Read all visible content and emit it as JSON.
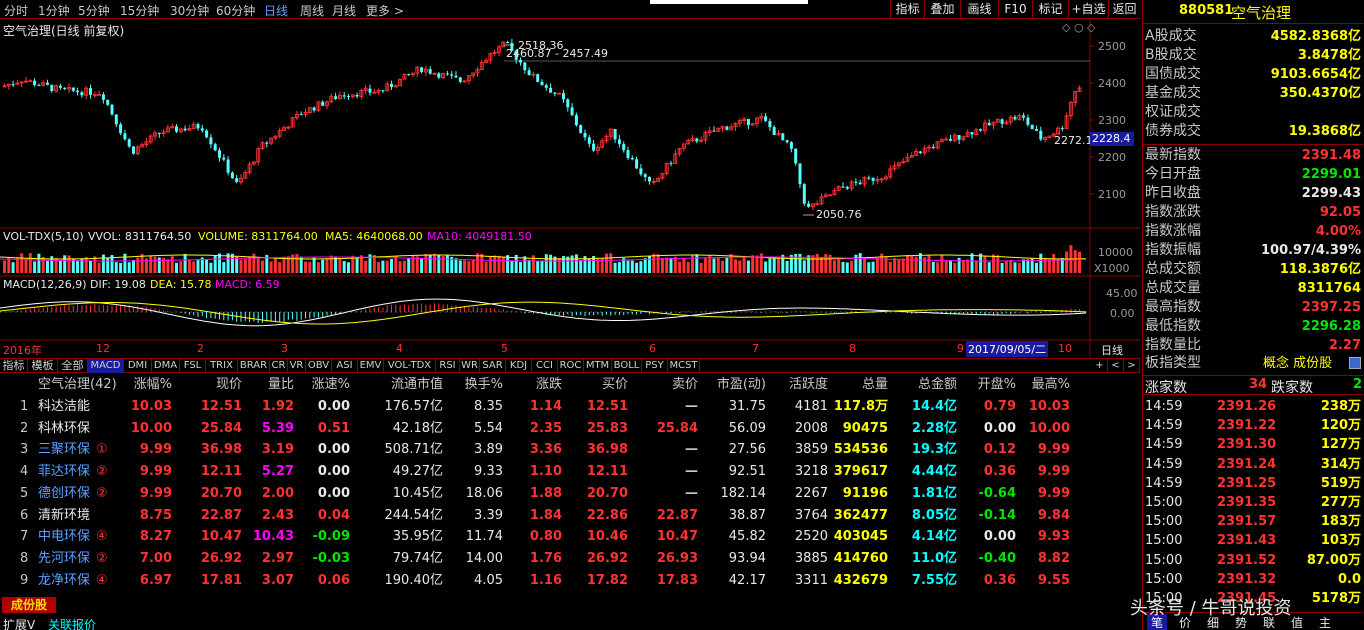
{
  "toolbar": {
    "periods": [
      "分时",
      "1分钟",
      "5分钟",
      "15分钟",
      "30分钟",
      "60分钟",
      "日线",
      "周线",
      "月线",
      "更多 >"
    ],
    "buttons": [
      "指标",
      "叠加",
      "画线",
      "F10",
      "标记",
      "+自选",
      "返回"
    ]
  },
  "chart": {
    "title": "空气治理(日线 前复权)",
    "y_ticks": [
      "2500",
      "2400",
      "2300",
      "2200",
      "2100"
    ],
    "high_label": "2518.36",
    "range_label": "2460.87 - 2457.49",
    "low_label": "2050.76",
    "last_label": "2272.1",
    "price_box": "2228.4",
    "vol_header": {
      "name": "VOL-TDX(5,10)",
      "vvol": "VVOL: 8311764.50",
      "volume": "VOLUME: 8311764.00",
      "ma5": "MA5: 4640068.00",
      "ma10": "MA10: 4049181.50"
    },
    "vol_ticks": [
      "10000",
      "X1000"
    ],
    "macd_header": {
      "name": "MACD(12,26,9)",
      "dif": "DIF: 19.08",
      "dea": "DEA: 15.78",
      "macd": "MACD: 6.59"
    },
    "macd_ticks": [
      "45.00",
      "0.00"
    ],
    "dates": [
      "2016年",
      "12",
      "2",
      "3",
      "4",
      "5",
      "6",
      "7",
      "8",
      "9",
      "10"
    ],
    "cursor_date": "2017/09/05/二",
    "period_label": "日线"
  },
  "tabs": [
    "指标",
    "模板",
    "全部",
    "MACD",
    "DMI",
    "DMA",
    "FSL",
    "TRIX",
    "BRAR",
    "CR",
    "VR",
    "OBV",
    "ASI",
    "EMV",
    "VOL-TDX",
    "RSI",
    "WR",
    "SAR",
    "KDJ",
    "CCI",
    "ROC",
    "MTM",
    "BOLL",
    "PSY",
    "MCST"
  ],
  "tab_nav": [
    "+",
    "<",
    ">"
  ],
  "table": {
    "headers": [
      "空气治理(42)",
      "涨幅%",
      "现价",
      "量比",
      "涨速%",
      "流通市值",
      "换手%",
      "涨跌",
      "买价",
      "卖价",
      "市盈(动)",
      "活跃度",
      "总量",
      "总金额",
      "开盘%",
      "最高%"
    ],
    "rows": [
      [
        "1",
        "科达洁能",
        "",
        "10.03",
        "12.51",
        "1.92",
        "0.00",
        "176.57亿",
        "8.35",
        "1.14",
        "12.51",
        "—",
        "31.75",
        "4181",
        "117.8万",
        "14.4亿",
        "0.79",
        "10.03"
      ],
      [
        "2",
        "科林环保",
        "",
        "10.00",
        "25.84",
        "5.39",
        "0.51",
        "42.18亿",
        "5.54",
        "2.35",
        "25.83",
        "25.84",
        "56.09",
        "2008",
        "90475",
        "2.28亿",
        "0.00",
        "10.00"
      ],
      [
        "3",
        "三聚环保",
        "①",
        "9.99",
        "36.98",
        "3.19",
        "0.00",
        "508.71亿",
        "3.89",
        "3.36",
        "36.98",
        "—",
        "27.56",
        "3859",
        "534536",
        "19.3亿",
        "0.12",
        "9.99"
      ],
      [
        "4",
        "菲达环保",
        "②",
        "9.99",
        "12.11",
        "5.27",
        "0.00",
        "49.27亿",
        "9.33",
        "1.10",
        "12.11",
        "—",
        "92.51",
        "3218",
        "379617",
        "4.44亿",
        "0.36",
        "9.99"
      ],
      [
        "5",
        "德创环保",
        "②",
        "9.99",
        "20.70",
        "2.00",
        "0.00",
        "10.45亿",
        "18.06",
        "1.88",
        "20.70",
        "—",
        "182.14",
        "2267",
        "91196",
        "1.81亿",
        "-0.64",
        "9.99"
      ],
      [
        "6",
        "清新环境",
        "",
        "8.75",
        "22.87",
        "2.43",
        "0.04",
        "244.54亿",
        "3.39",
        "1.84",
        "22.86",
        "22.87",
        "38.87",
        "3764",
        "362477",
        "8.05亿",
        "-0.14",
        "9.84"
      ],
      [
        "7",
        "中电环保",
        "④",
        "8.27",
        "10.47",
        "10.43",
        "-0.09",
        "35.95亿",
        "11.74",
        "0.80",
        "10.46",
        "10.47",
        "45.82",
        "2520",
        "403045",
        "4.14亿",
        "0.00",
        "9.93"
      ],
      [
        "8",
        "先河环保",
        "②",
        "7.00",
        "26.92",
        "2.97",
        "-0.03",
        "79.74亿",
        "14.00",
        "1.76",
        "26.92",
        "26.93",
        "93.94",
        "3885",
        "414760",
        "11.0亿",
        "-0.40",
        "8.82"
      ],
      [
        "9",
        "龙净环保",
        "④",
        "6.97",
        "17.81",
        "3.07",
        "0.06",
        "190.40亿",
        "4.05",
        "1.16",
        "17.82",
        "17.83",
        "42.17",
        "3311",
        "432679",
        "7.55亿",
        "0.36",
        "9.55"
      ]
    ]
  },
  "bottom": {
    "badge": "成份股",
    "expand": "扩展V",
    "related": "关联报价",
    "watermark": "头条号 / 牛哥说投资",
    "tabs": [
      "笔",
      "价",
      "细",
      "势",
      "联",
      "值",
      "主"
    ]
  },
  "right": {
    "code": "880581",
    "name": "空气治理",
    "stats": [
      [
        "A股成交",
        "4582.8368亿"
      ],
      [
        "B股成交",
        "3.8478亿"
      ],
      [
        "国债成交",
        "9103.6654亿"
      ],
      [
        "基金成交",
        "350.4370亿"
      ],
      [
        "权证成交",
        ""
      ],
      [
        "债券成交",
        "19.3868亿"
      ]
    ],
    "quote": [
      [
        "最新指数",
        "2391.48",
        "r"
      ],
      [
        "今日开盘",
        "2299.01",
        "g"
      ],
      [
        "昨日收盘",
        "2299.43",
        "w"
      ],
      [
        "指数涨跌",
        "92.05",
        "r"
      ],
      [
        "指数涨幅",
        "4.00%",
        "r"
      ],
      [
        "指数振幅",
        "100.97/4.39%",
        "w"
      ],
      [
        "总成交额",
        "118.3876亿",
        "y"
      ],
      [
        "总成交量",
        "8311764",
        "y"
      ],
      [
        "最高指数",
        "2397.25",
        "r"
      ],
      [
        "最低指数",
        "2296.28",
        "g"
      ],
      [
        "指数量比",
        "2.27",
        "r"
      ]
    ],
    "plate_label": "板指类型",
    "plate_value": "概念 成份股",
    "updown": {
      "up_label": "涨家数",
      "up": "34",
      "down_label": "跌家数",
      "down": "2"
    },
    "ticks": [
      [
        "14:59",
        "2391.26",
        "238万"
      ],
      [
        "14:59",
        "2391.22",
        "120万"
      ],
      [
        "14:59",
        "2391.30",
        "127万"
      ],
      [
        "14:59",
        "2391.24",
        "314万"
      ],
      [
        "14:59",
        "2391.25",
        "519万"
      ],
      [
        "15:00",
        "2391.35",
        "277万"
      ],
      [
        "15:00",
        "2391.57",
        "183万"
      ],
      [
        "15:00",
        "2391.43",
        "103万"
      ],
      [
        "15:00",
        "2391.52",
        "87.00万"
      ],
      [
        "15:00",
        "2391.32",
        "0.0"
      ],
      [
        "15:00",
        "2391.45",
        "5178万"
      ],
      [
        "15:00",
        "2391.48",
        "..."
      ]
    ]
  },
  "colors": {
    "up": "#ff3232",
    "down": "#54ffff",
    "grid_line": "#8b0000",
    "yellow": "#ffff00",
    "magenta": "#ff00ff"
  }
}
